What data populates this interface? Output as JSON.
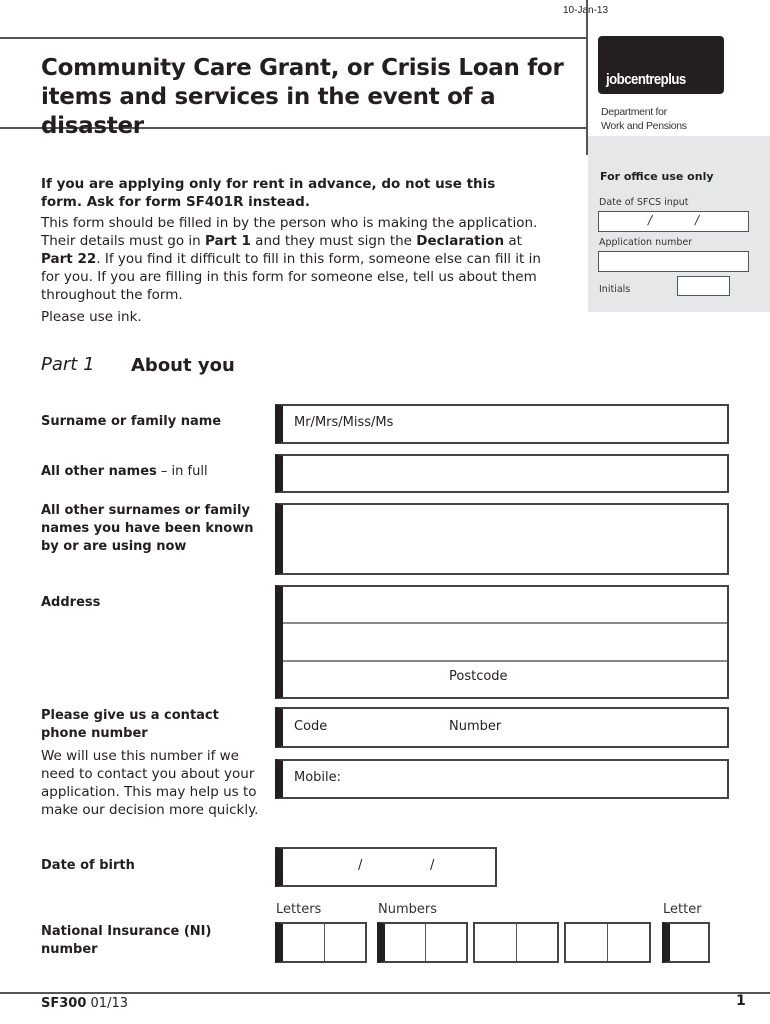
{
  "print_date": "10-Jan-13",
  "header": {
    "title": "Community Care Grant, or Crisis Loan for items and services in the event of a disaster",
    "logo_text": "jobcentreplus",
    "department_line1": "Department for",
    "department_line2": "Work and Pensions"
  },
  "office_use": {
    "title": "For office use only",
    "date_label": "Date of SFCS input",
    "date_separator": "/",
    "application_number_label": "Application number",
    "initials_label": "Initials"
  },
  "intro": {
    "warning": "If you are applying only for rent in advance, do not use this form. Ask for form SF401R instead.",
    "body_parts": [
      "This form should be filled in by the person who is making the application. Their details must go in ",
      "Part 1",
      " and they must sign the ",
      "Declaration",
      " at ",
      "Part 22",
      ". If you find it difficult to fill in this form, someone else can fill it in for you. If you are filling in this form for someone else, tell us about them throughout the form."
    ],
    "ink_note": "Please use ink."
  },
  "part": {
    "number": "Part 1",
    "title": "About you"
  },
  "fields": {
    "surname": {
      "label": "Surname or family name",
      "prefill": "Mr/Mrs/Miss/Ms"
    },
    "other_names": {
      "label": "All other names",
      "label_suffix": " – in full"
    },
    "other_surnames": {
      "label": "All other surnames or family names you have been known by or are using now"
    },
    "address": {
      "label": "Address",
      "postcode_label": "Postcode"
    },
    "phone": {
      "label": "Please give us a contact phone number",
      "help": "We will use this number if we need to contact you about your application. This may help us to make our decision more quickly.",
      "code_label": "Code",
      "number_label": "Number",
      "mobile_label": "Mobile:"
    },
    "dob": {
      "label": "Date of birth",
      "separator": "/"
    },
    "ni": {
      "label": "National Insurance (NI) number",
      "letters_caption": "Letters",
      "numbers_caption": "Numbers",
      "letter_caption": "Letter"
    }
  },
  "footer": {
    "form_code": "SF300",
    "form_date": "01/13",
    "page_number": "1"
  }
}
